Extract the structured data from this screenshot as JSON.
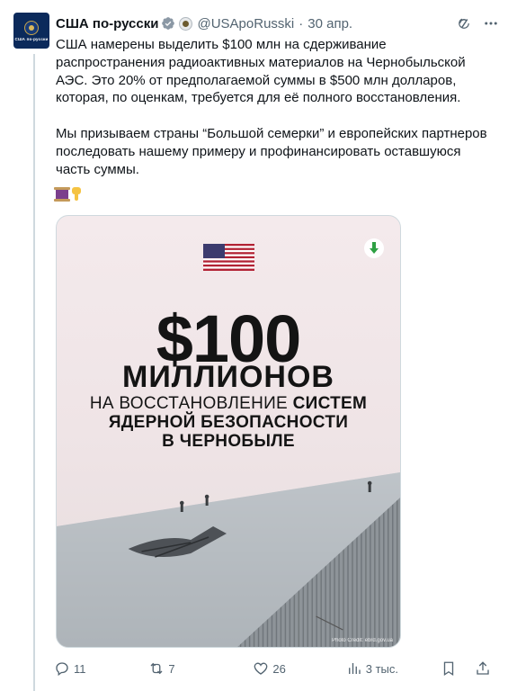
{
  "tweet": {
    "author_name": "США по-русски",
    "handle": "@USApoRusski",
    "separator": "·",
    "date": "30 апр.",
    "avatar_text": "США по-русски",
    "paragraphs": [
      "США намерены выделить $100 млн на сдерживание распространения радиоактивных материалов на Чернобыльской АЭС. Это 20% от предполагаемой суммы в $500 млн долларов, которая, по оценкам, требуется для её полного восстановления.",
      "Мы призываем страны “Большой семерки” и европейских партнеров последовать нашему примеру и профинансировать оставшуюся часть суммы."
    ],
    "emojis": [
      "spool-emoji",
      "pointing-down-emoji"
    ]
  },
  "media": {
    "amount": "$100",
    "millions": "МИЛЛИОНОВ",
    "line3_normal": "НА ВОССТАНОВЛЕНИЕ ",
    "line3_bold": "СИСТЕМ",
    "line4": "ЯДЕРНОЙ БЕЗОПАСНОСТИ",
    "line5": "В ЧЕРНОБЫЛЕ",
    "credit": "Photo Credit: ebrd.gov.ua",
    "icons": [
      "us-flag-icon",
      "download-icon"
    ]
  },
  "actions": {
    "replies": "11",
    "reposts": "7",
    "likes": "26",
    "views": "3 тыс."
  },
  "colors": {
    "text": "#0f1419",
    "secondary": "#536471",
    "verified": "#1d9bf0",
    "accent_green": "#2ea043"
  }
}
